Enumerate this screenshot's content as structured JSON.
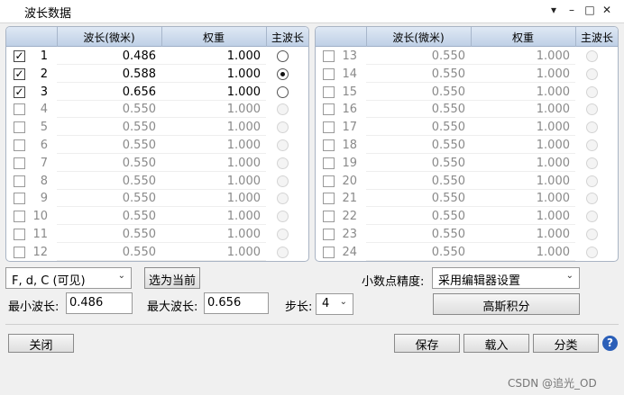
{
  "window": {
    "title": "波长数据",
    "controls": [
      "▾",
      "–",
      "□",
      "✕"
    ]
  },
  "table": {
    "columns": {
      "wavelength": "波长(微米)",
      "weight": "权重",
      "primary": "主波长"
    },
    "rows": [
      {
        "num": "1",
        "checked": true,
        "wavelength": "0.486",
        "weight": "1.000",
        "primary": false,
        "active": true
      },
      {
        "num": "2",
        "checked": true,
        "wavelength": "0.588",
        "weight": "1.000",
        "primary": true,
        "active": true
      },
      {
        "num": "3",
        "checked": true,
        "wavelength": "0.656",
        "weight": "1.000",
        "primary": false,
        "active": true
      },
      {
        "num": "4",
        "checked": false,
        "wavelength": "0.550",
        "weight": "1.000",
        "primary": false,
        "active": false
      },
      {
        "num": "5",
        "checked": false,
        "wavelength": "0.550",
        "weight": "1.000",
        "primary": false,
        "active": false
      },
      {
        "num": "6",
        "checked": false,
        "wavelength": "0.550",
        "weight": "1.000",
        "primary": false,
        "active": false
      },
      {
        "num": "7",
        "checked": false,
        "wavelength": "0.550",
        "weight": "1.000",
        "primary": false,
        "active": false
      },
      {
        "num": "8",
        "checked": false,
        "wavelength": "0.550",
        "weight": "1.000",
        "primary": false,
        "active": false
      },
      {
        "num": "9",
        "checked": false,
        "wavelength": "0.550",
        "weight": "1.000",
        "primary": false,
        "active": false
      },
      {
        "num": "10",
        "checked": false,
        "wavelength": "0.550",
        "weight": "1.000",
        "primary": false,
        "active": false
      },
      {
        "num": "11",
        "checked": false,
        "wavelength": "0.550",
        "weight": "1.000",
        "primary": false,
        "active": false
      },
      {
        "num": "12",
        "checked": false,
        "wavelength": "0.550",
        "weight": "1.000",
        "primary": false,
        "active": false
      },
      {
        "num": "13",
        "checked": false,
        "wavelength": "0.550",
        "weight": "1.000",
        "primary": false,
        "active": false
      },
      {
        "num": "14",
        "checked": false,
        "wavelength": "0.550",
        "weight": "1.000",
        "primary": false,
        "active": false
      },
      {
        "num": "15",
        "checked": false,
        "wavelength": "0.550",
        "weight": "1.000",
        "primary": false,
        "active": false
      },
      {
        "num": "16",
        "checked": false,
        "wavelength": "0.550",
        "weight": "1.000",
        "primary": false,
        "active": false
      },
      {
        "num": "17",
        "checked": false,
        "wavelength": "0.550",
        "weight": "1.000",
        "primary": false,
        "active": false
      },
      {
        "num": "18",
        "checked": false,
        "wavelength": "0.550",
        "weight": "1.000",
        "primary": false,
        "active": false
      },
      {
        "num": "19",
        "checked": false,
        "wavelength": "0.550",
        "weight": "1.000",
        "primary": false,
        "active": false
      },
      {
        "num": "20",
        "checked": false,
        "wavelength": "0.550",
        "weight": "1.000",
        "primary": false,
        "active": false
      },
      {
        "num": "21",
        "checked": false,
        "wavelength": "0.550",
        "weight": "1.000",
        "primary": false,
        "active": false
      },
      {
        "num": "22",
        "checked": false,
        "wavelength": "0.550",
        "weight": "1.000",
        "primary": false,
        "active": false
      },
      {
        "num": "23",
        "checked": false,
        "wavelength": "0.550",
        "weight": "1.000",
        "primary": false,
        "active": false
      },
      {
        "num": "24",
        "checked": false,
        "wavelength": "0.550",
        "weight": "1.000",
        "primary": false,
        "active": false
      }
    ]
  },
  "controls": {
    "preset": "F, d, C (可见)",
    "select_current": "选为当前",
    "decimal_label": "小数点精度:",
    "decimal_value": "采用编辑器设置",
    "min_label": "最小波长:",
    "min_value": "0.486",
    "max_label": "最大波长:",
    "max_value": "0.656",
    "step_label": "步长:",
    "step_value": "4",
    "gauss": "高斯积分"
  },
  "footer": {
    "close": "关闭",
    "save": "保存",
    "load": "载入",
    "classify": "分类",
    "help": "?"
  },
  "watermark": "CSDN @追光_OD"
}
